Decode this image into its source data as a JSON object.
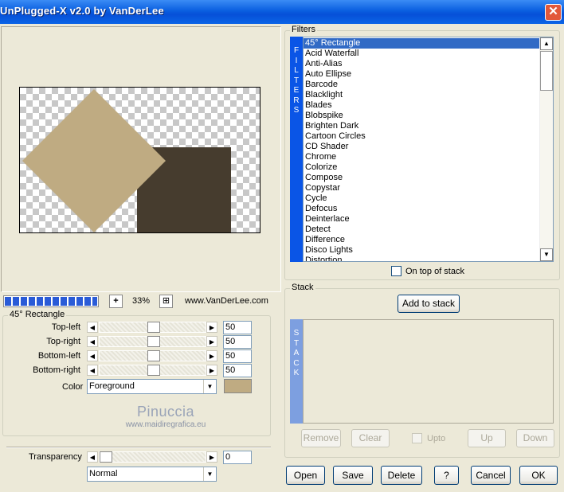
{
  "window": {
    "title": "UnPlugged-X v2.0 by VanDerLee",
    "close_glyph": "✕"
  },
  "zoom": {
    "plus": "+",
    "value": "33%",
    "fit_glyph": "⊞"
  },
  "website": "www.VanDerLee.com",
  "params": {
    "group_title": "45° Rectangle",
    "sliders": [
      {
        "label": "Top-left",
        "value": "50",
        "level": 0.5
      },
      {
        "label": "Top-right",
        "value": "50",
        "level": 0.5
      },
      {
        "label": "Bottom-left",
        "value": "50",
        "level": 0.5
      },
      {
        "label": "Bottom-right",
        "value": "50",
        "level": 0.5
      }
    ],
    "color_label": "Color",
    "color_value": "Foreground",
    "swatch_color": "#bfab82"
  },
  "watermark": {
    "name": "Pinuccia",
    "site": "www.maidiregrafica.eu"
  },
  "transparency": {
    "label": "Transparency",
    "value": "0",
    "level": 0.0,
    "blend_mode": "Normal"
  },
  "filters": {
    "group_title": "Filters",
    "side_letters": [
      "F",
      "I",
      "L",
      "T",
      "E",
      "R",
      "S"
    ],
    "items": [
      "45° Rectangle",
      "Acid Waterfall",
      "Anti-Alias",
      "Auto Ellipse",
      "Barcode",
      "Blacklight",
      "Blades",
      "Blobspike",
      "Brighten Dark",
      "Cartoon Circles",
      "CD Shader",
      "Chrome",
      "Colorize",
      "Compose",
      "Copystar",
      "Cycle",
      "Defocus",
      "Deinterlace",
      "Detect",
      "Difference",
      "Disco Lights",
      "Distortion"
    ],
    "selected_index": 0,
    "on_top_label": "On top of stack",
    "scroll_up": "▲",
    "scroll_down": "▼"
  },
  "stack": {
    "group_title": "Stack",
    "add_label": "Add to stack",
    "side_letters": [
      "S",
      "T",
      "A",
      "C",
      "K"
    ],
    "remove_label": "Remove",
    "clear_label": "Clear",
    "upto_label": "Upto",
    "up_label": "Up",
    "down_label": "Down"
  },
  "bottom_buttons": {
    "open": "Open",
    "save": "Save",
    "delete": "Delete",
    "help": "?",
    "cancel": "Cancel",
    "ok": "OK"
  },
  "arrows": {
    "left": "◀",
    "right": "▶",
    "down": "▼"
  },
  "colors": {
    "diamond": "#bfab82",
    "rect": "#463c2e",
    "progress": "#2a5bd7",
    "filters_sidebar": "#0a55e6",
    "stack_sidebar": "#7d9fe0"
  }
}
